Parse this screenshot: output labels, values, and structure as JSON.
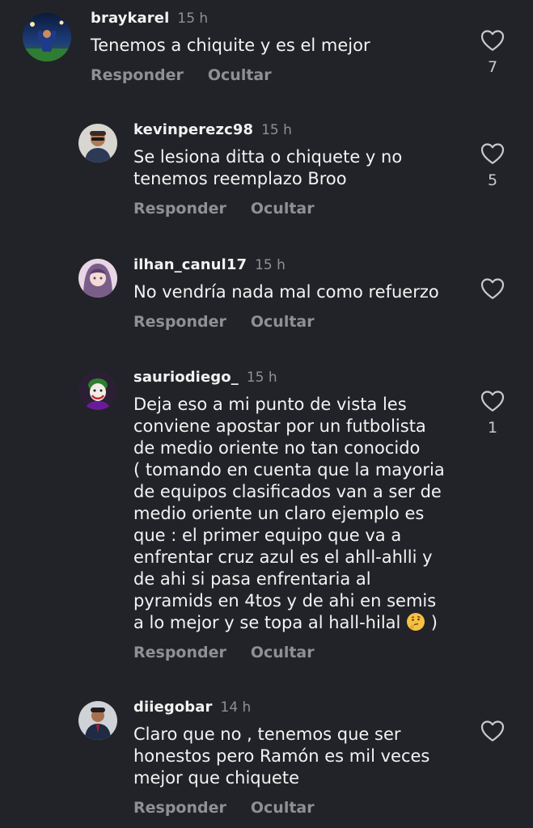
{
  "comments": [
    {
      "username": "braykarel",
      "time": "15 h",
      "text": "Tenemos a chiquite y es el mejor",
      "reply_label": "Responder",
      "hide_label": "Ocultar",
      "likes": "7"
    },
    {
      "username": "kevinperezc98",
      "time": "15 h",
      "text": "Se lesiona ditta o chiquete y no\ntenemos reemplazo Broo",
      "reply_label": "Responder",
      "hide_label": "Ocultar",
      "likes": "5"
    },
    {
      "username": "ilhan_canul17",
      "time": "15 h",
      "text": "No vendría nada mal como refuerzo",
      "reply_label": "Responder",
      "hide_label": "Ocultar",
      "likes": ""
    },
    {
      "username": "sauriodiego_",
      "time": "15 h",
      "text": "Deja eso a mi punto de vista les\nconviene apostar por un futbolista\nde medio oriente no tan conocido\n( tomando en cuenta que la mayoria\nde equipos clasificados van a ser de\nmedio oriente un claro ejemplo es\nque : el primer equipo que va a\nenfrentar cruz azul es el ahll-ahlli y\nde ahi si pasa enfrentaria al\npyramids en 4tos y de ahi en semis\na lo mejor y se topa al hall-hilal",
      "text_end": " )",
      "emoji": "thinking-face",
      "reply_label": "Responder",
      "hide_label": "Ocultar",
      "likes": "1"
    },
    {
      "username": "diiegobar",
      "time": "14 h",
      "text": "Claro que no , tenemos que ser\nhonestos pero Ramón es mil veces\nmejor que chiquete",
      "reply_label": "Responder",
      "hide_label": "Ocultar",
      "likes": ""
    }
  ],
  "icons": {
    "like": "heart-outline-icon"
  },
  "colors": {
    "background": "#212328",
    "text": "#f2f2f2",
    "secondary": "#8e9096"
  }
}
